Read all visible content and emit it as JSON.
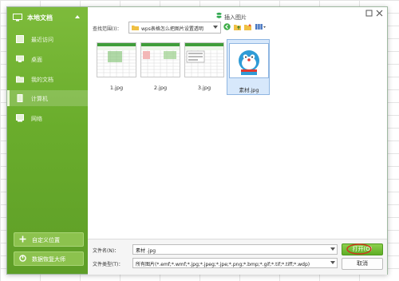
{
  "sidebar": {
    "title": "本地文档",
    "items": [
      {
        "label": "最近访问",
        "icon": "clock-icon"
      },
      {
        "label": "桌面",
        "icon": "desktop-icon"
      },
      {
        "label": "我的文档",
        "icon": "folder-icon"
      },
      {
        "label": "计算机",
        "icon": "computer-icon",
        "active": true
      },
      {
        "label": "网络",
        "icon": "network-icon"
      }
    ],
    "custom_location": "自定义位置",
    "data_recovery": "数据恢复大师"
  },
  "dialog": {
    "title": "插入图片",
    "look_in_label": "查找范围(I)：",
    "look_in_value": "wps表格怎么把图片设置透明"
  },
  "files": [
    {
      "name": "1.jpg"
    },
    {
      "name": "2.jpg"
    },
    {
      "name": "3.jpg"
    },
    {
      "name": "素材.jpg",
      "selected": true
    }
  ],
  "footer": {
    "filename_label": "文件名(N)：",
    "filename_value": "素材 .jpg",
    "filetype_label": "文件类型(T)：",
    "filetype_value": "所有图片(*.emf;*.wmf;*.jpg;*.jpeg;*.jpe;*.png;*.bmp;*.gif;*.tif;*.tiff;*.wdp)",
    "open_button": "打开(O)",
    "cancel_button": "取消"
  },
  "colors": {
    "accent": "#6aad2c",
    "selection": "#d7e8fb"
  }
}
